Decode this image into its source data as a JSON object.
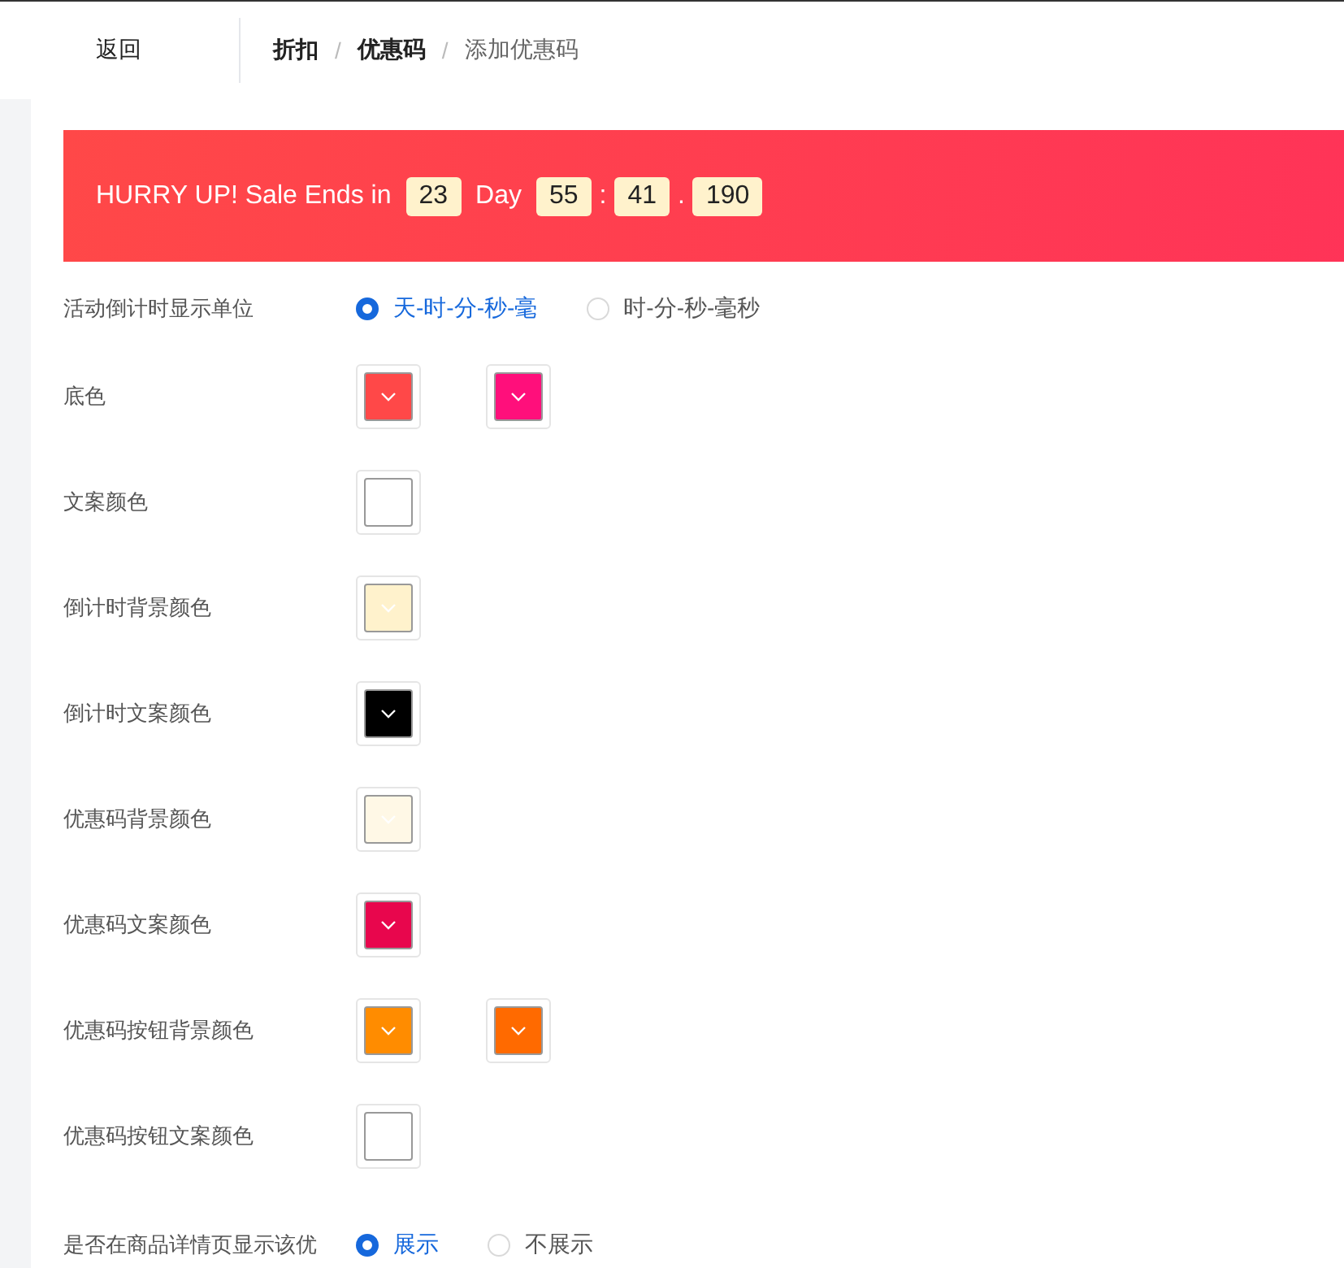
{
  "header": {
    "back": "返回",
    "breadcrumb": [
      {
        "label": "折扣",
        "current": false
      },
      {
        "label": "优惠码",
        "current": false
      },
      {
        "label": "添加优惠码",
        "current": true
      }
    ],
    "separator": "/"
  },
  "banner": {
    "prefix": "HURRY UP! Sale Ends in",
    "segments": [
      {
        "kind": "box",
        "text": "23"
      },
      {
        "kind": "word",
        "text": "Day"
      },
      {
        "kind": "box",
        "text": "55"
      },
      {
        "kind": "sep",
        "text": ":"
      },
      {
        "kind": "box",
        "text": "41"
      },
      {
        "kind": "sep",
        "text": "."
      },
      {
        "kind": "box",
        "text": "190"
      }
    ]
  },
  "fields": [
    {
      "kind": "radio",
      "label": "活动倒计时显示单位",
      "options": [
        {
          "label": "天-时-分-秒-毫",
          "selected": true
        },
        {
          "label": "时-分-秒-毫秒",
          "selected": false
        }
      ]
    },
    {
      "kind": "colors",
      "label": "底色",
      "swatches": [
        {
          "color": "#ff4848"
        },
        {
          "color": "#ff0f7b"
        }
      ]
    },
    {
      "kind": "colors",
      "label": "文案颜色",
      "swatches": [
        {
          "color": "#ffffff"
        }
      ]
    },
    {
      "kind": "colors",
      "label": "倒计时背景颜色",
      "swatches": [
        {
          "color": "#fff2cc"
        }
      ]
    },
    {
      "kind": "colors",
      "label": "倒计时文案颜色",
      "swatches": [
        {
          "color": "#000000"
        }
      ]
    },
    {
      "kind": "colors",
      "label": "优惠码背景颜色",
      "swatches": [
        {
          "color": "#fff8e6"
        }
      ]
    },
    {
      "kind": "colors",
      "label": "优惠码文案颜色",
      "swatches": [
        {
          "color": "#e8064d"
        }
      ]
    },
    {
      "kind": "colors",
      "label": "优惠码按钮背景颜色",
      "swatches": [
        {
          "color": "#ff8c00"
        },
        {
          "color": "#ff6a00"
        }
      ]
    },
    {
      "kind": "colors",
      "label": "优惠码按钮文案颜色",
      "swatches": [
        {
          "color": "#ffffff"
        }
      ]
    },
    {
      "kind": "radio",
      "label": "是否在商品详情页显示该优",
      "options": [
        {
          "label": "展示",
          "selected": true
        },
        {
          "label": "不展示",
          "selected": false
        }
      ]
    }
  ]
}
